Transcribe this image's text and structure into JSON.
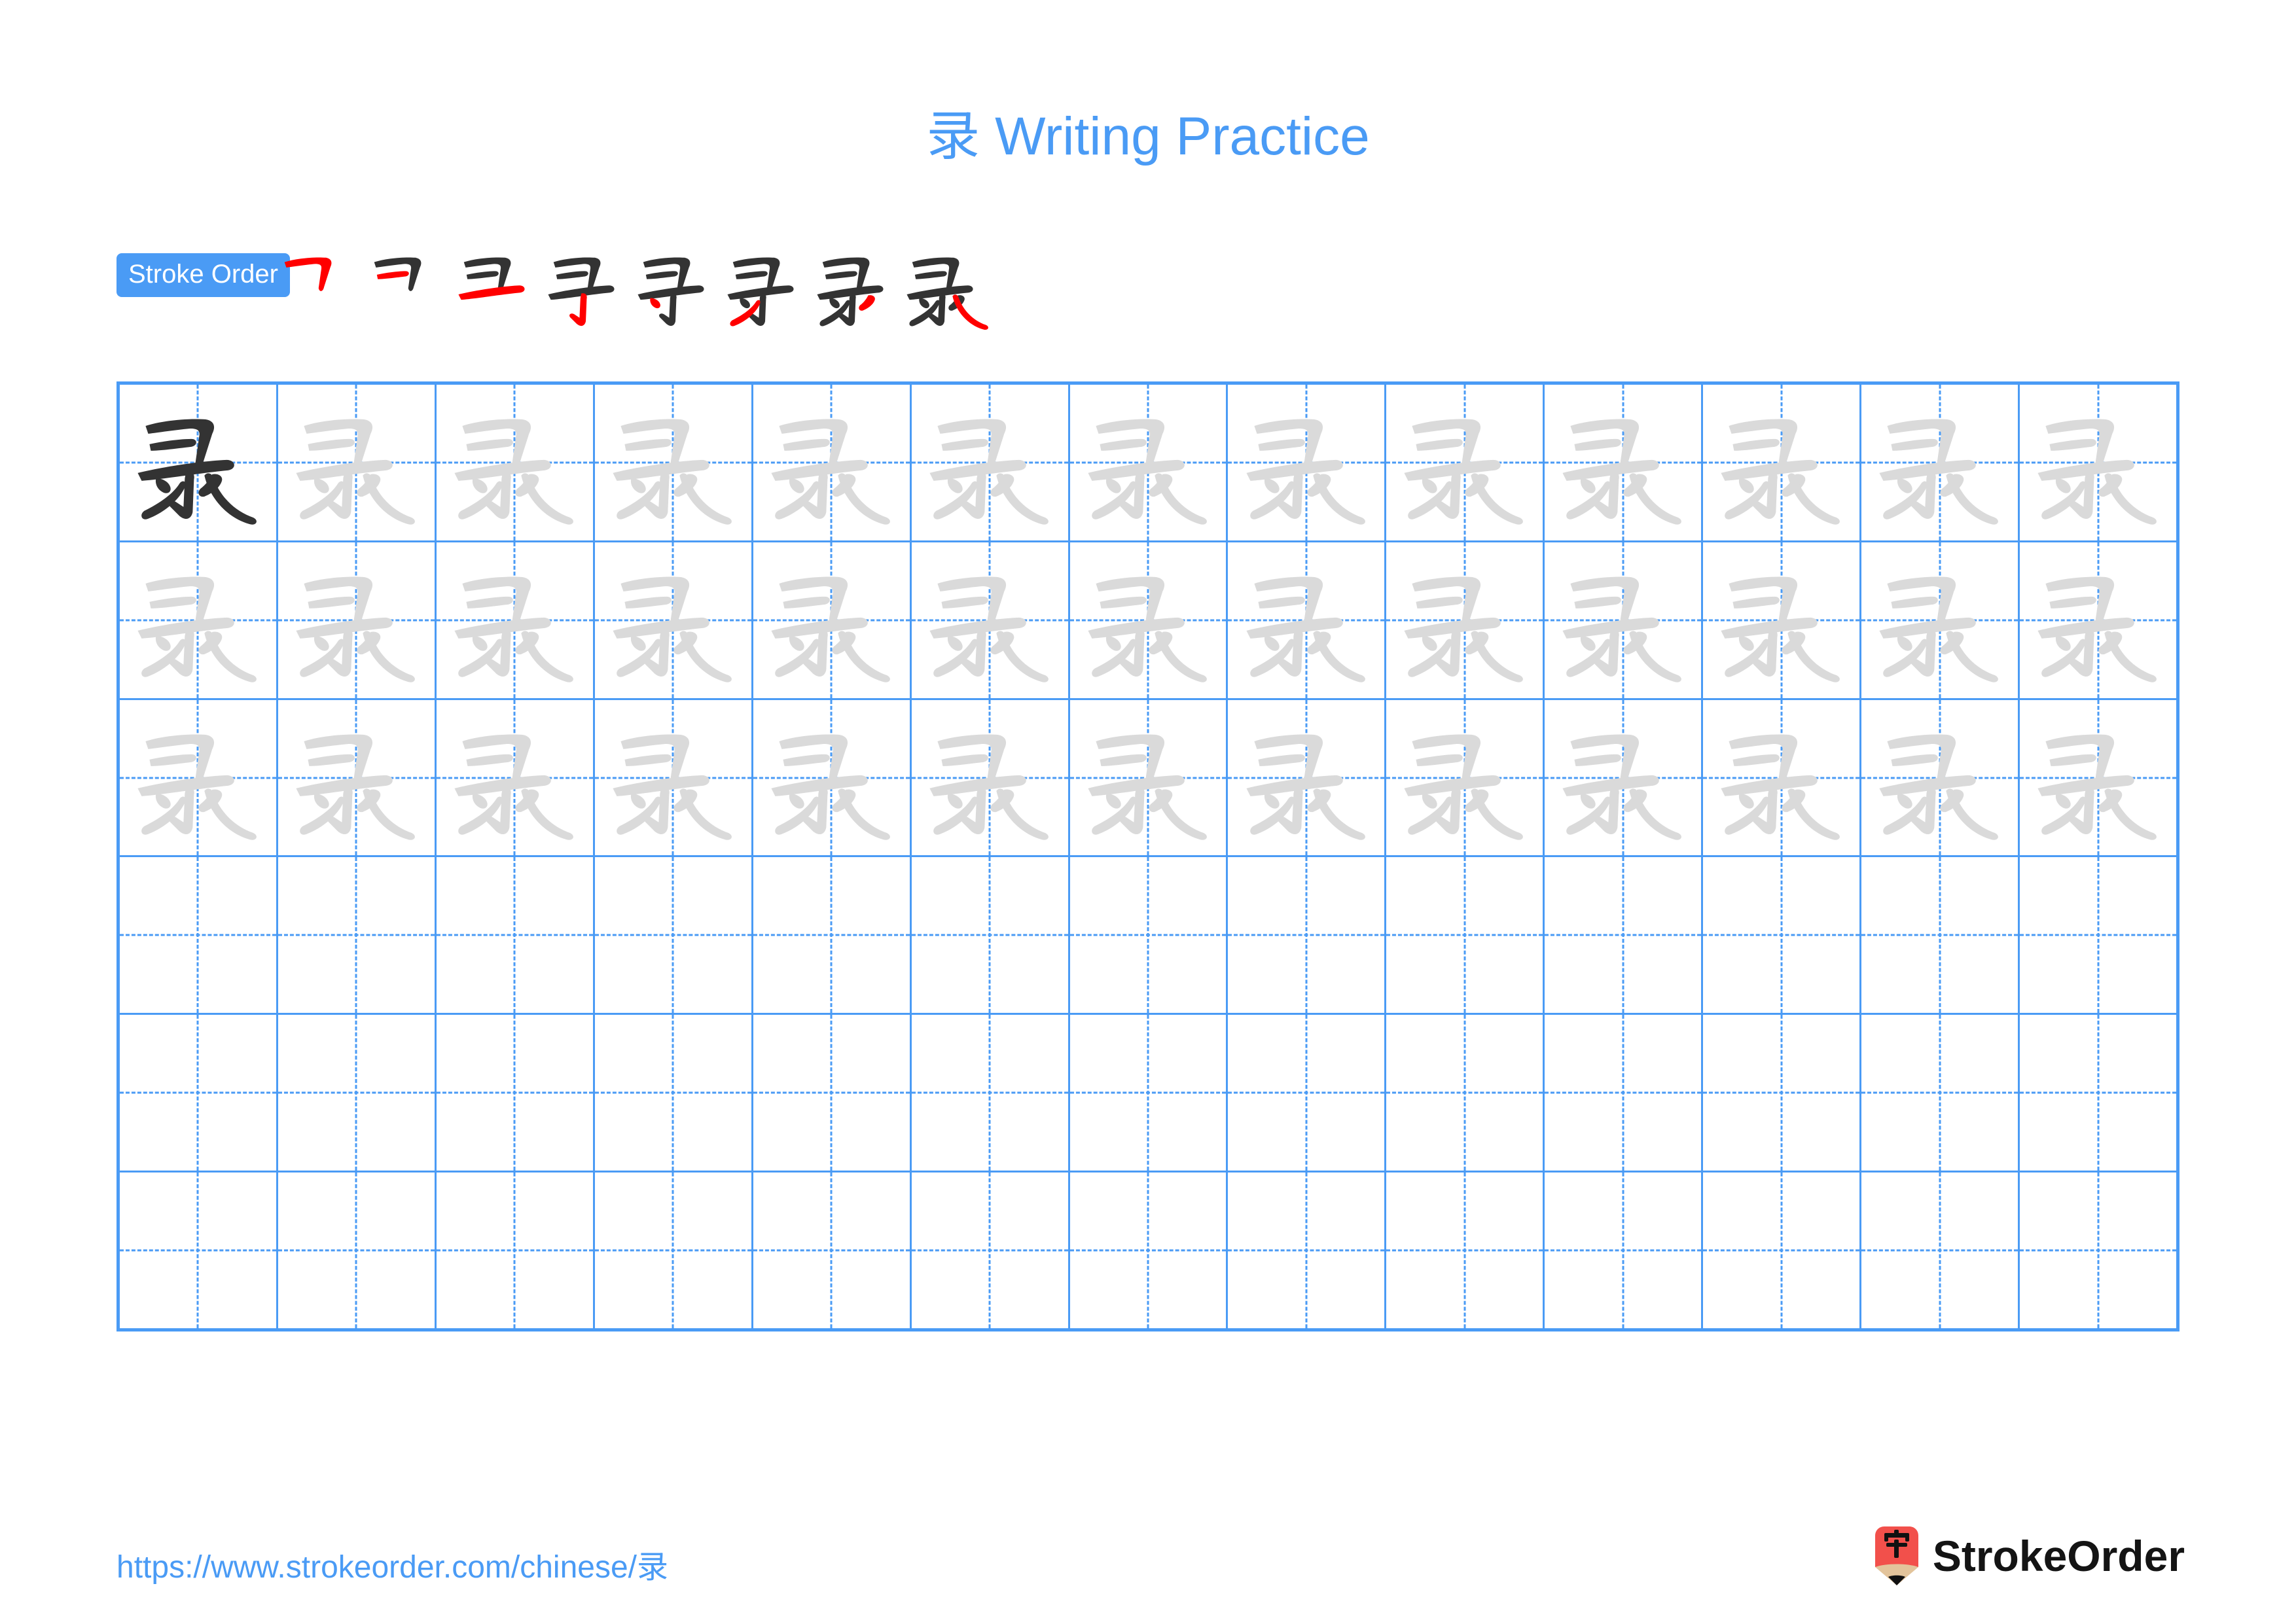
{
  "page": {
    "character": "录",
    "title": "录 Writing Practice",
    "title_character": "录",
    "title_text": " Writing Practice",
    "background_color": "#ffffff",
    "accent_color": "#4A9BF5",
    "new_stroke_color": "#FF0000",
    "done_stroke_color": "#333333",
    "trace_color": "#DADADA",
    "model_color": "#333333"
  },
  "stroke_order": {
    "badge_label": "Stroke Order",
    "total_strokes": 8,
    "steps": [
      {
        "index": 1,
        "name": "stroke-step-1",
        "new_stroke": "横折 (horizontal-turn)"
      },
      {
        "index": 2,
        "name": "stroke-step-2",
        "new_stroke": "横 (horizontal)"
      },
      {
        "index": 3,
        "name": "stroke-step-3",
        "new_stroke": "横 (horizontal)"
      },
      {
        "index": 4,
        "name": "stroke-step-4",
        "new_stroke": "竖钩 (vertical-hook)"
      },
      {
        "index": 5,
        "name": "stroke-step-5",
        "new_stroke": "点 (dot)"
      },
      {
        "index": 6,
        "name": "stroke-step-6",
        "new_stroke": "撇 (left-falling)"
      },
      {
        "index": 7,
        "name": "stroke-step-7",
        "new_stroke": "点 (dot)"
      },
      {
        "index": 8,
        "name": "stroke-step-8",
        "new_stroke": "捺 (right-falling)"
      }
    ]
  },
  "practice_grid": {
    "columns": 13,
    "rows": 6,
    "cells": [
      [
        "model",
        "trace",
        "trace",
        "trace",
        "trace",
        "trace",
        "trace",
        "trace",
        "trace",
        "trace",
        "trace",
        "trace",
        "trace"
      ],
      [
        "trace",
        "trace",
        "trace",
        "trace",
        "trace",
        "trace",
        "trace",
        "trace",
        "trace",
        "trace",
        "trace",
        "trace",
        "trace"
      ],
      [
        "trace",
        "trace",
        "trace",
        "trace",
        "trace",
        "trace",
        "trace",
        "trace",
        "trace",
        "trace",
        "trace",
        "trace",
        "trace"
      ],
      [
        "empty",
        "empty",
        "empty",
        "empty",
        "empty",
        "empty",
        "empty",
        "empty",
        "empty",
        "empty",
        "empty",
        "empty",
        "empty"
      ],
      [
        "empty",
        "empty",
        "empty",
        "empty",
        "empty",
        "empty",
        "empty",
        "empty",
        "empty",
        "empty",
        "empty",
        "empty",
        "empty"
      ],
      [
        "empty",
        "empty",
        "empty",
        "empty",
        "empty",
        "empty",
        "empty",
        "empty",
        "empty",
        "empty",
        "empty",
        "empty",
        "empty"
      ]
    ]
  },
  "footer": {
    "url_prefix": "https://www.strokeorder.com/chinese/",
    "url_character": "录",
    "url_full": "https://www.strokeorder.com/chinese/录",
    "brand_name": "StrokeOrder",
    "logo_character": "字",
    "logo_body_color": "#F2504B",
    "logo_wood_color": "#E3C49B",
    "logo_tip_color": "#111111"
  }
}
